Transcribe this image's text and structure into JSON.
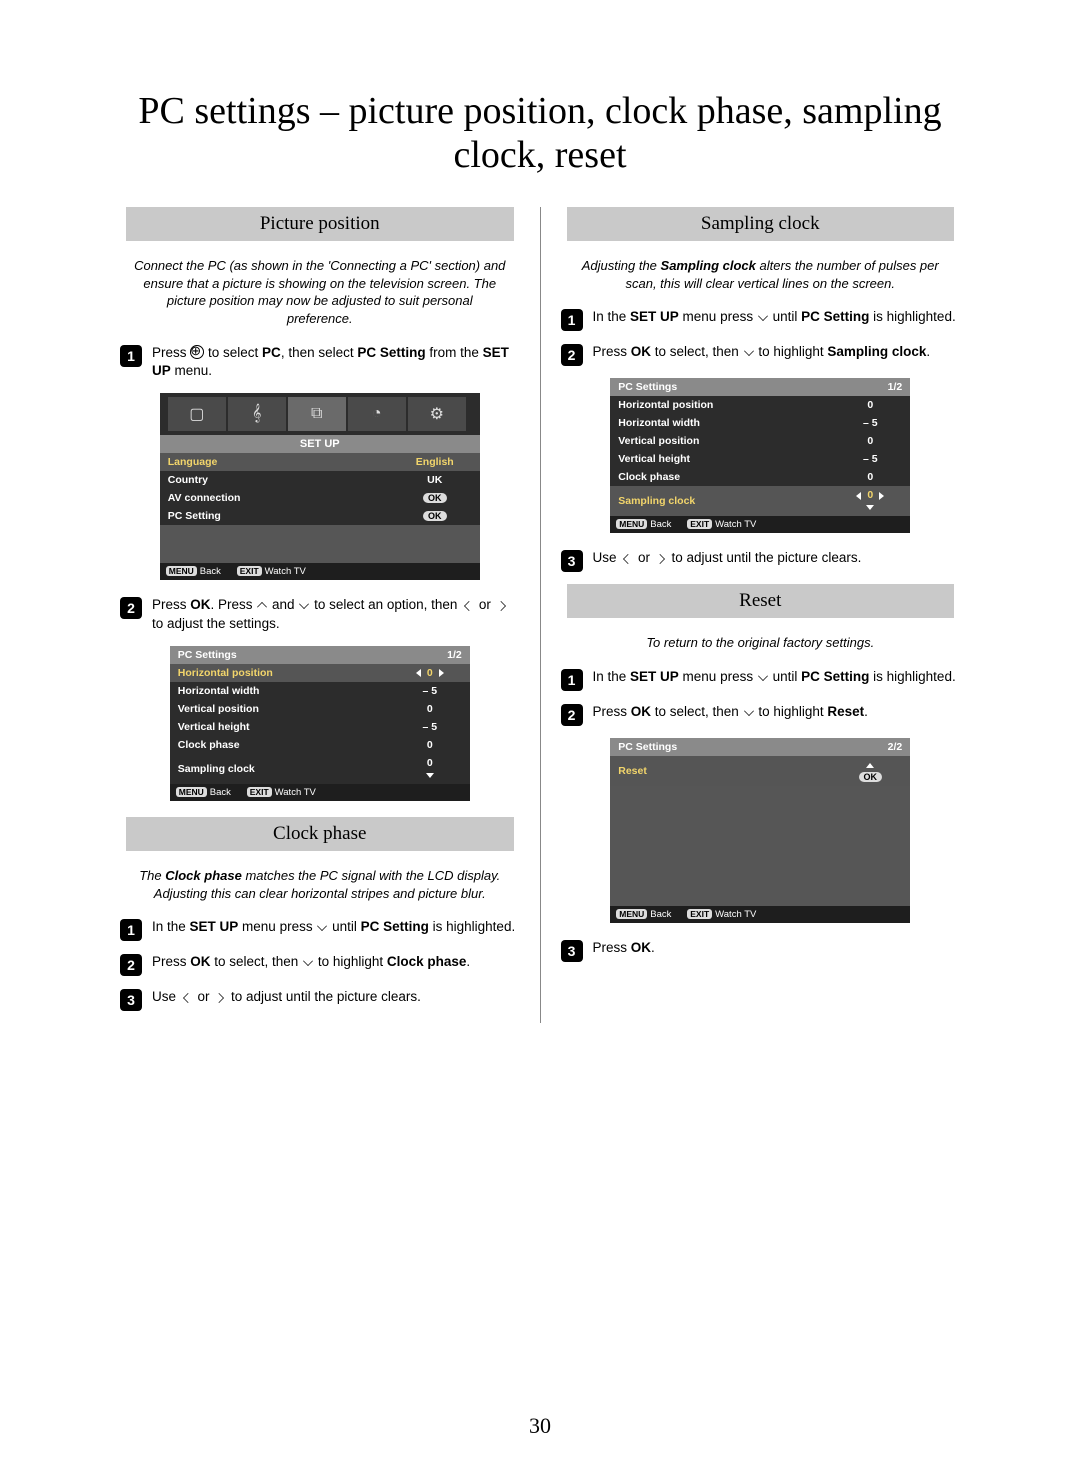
{
  "title": "PC settings – picture position, clock phase, sampling clock, reset",
  "page_number": "30",
  "left": {
    "picture_position": {
      "heading": "Picture position",
      "intro": "Connect the PC (as shown in the 'Connecting a PC' section) and ensure that a picture is showing on the television screen. The picture position may now be adjusted to suit personal preference.",
      "step1_a": "Press ",
      "step1_b": " to select ",
      "step1_pc": "PC",
      "step1_c": ", then select ",
      "step1_pcs": "PC Setting",
      "step1_d": " from the ",
      "step1_setup": "SET UP",
      "step1_e": " menu.",
      "step2_a": "Press ",
      "step2_ok": "OK",
      "step2_b": ". Press ",
      "step2_c": " and ",
      "step2_d": " to select an option, then ",
      "step2_e": " or ",
      "step2_f": " to adjust the settings."
    },
    "setup_menu": {
      "title": "SET UP",
      "rows": [
        {
          "label": "Language",
          "value": "English",
          "hl": true
        },
        {
          "label": "Country",
          "value": "UK"
        },
        {
          "label": "AV connection",
          "value": "OK"
        },
        {
          "label": "PC Setting",
          "value": "OK"
        }
      ],
      "footer_back": "Back",
      "footer_watch": "Watch TV",
      "menu_key": "MENU",
      "exit_key": "EXIT"
    },
    "pcsettings1": {
      "title": "PC Settings",
      "page": "1/2",
      "rows": [
        {
          "label": "Horizontal position",
          "value": "0",
          "hl": true,
          "arrows": true
        },
        {
          "label": "Horizontal width",
          "value": "– 5"
        },
        {
          "label": "Vertical position",
          "value": "0"
        },
        {
          "label": "Vertical height",
          "value": "– 5"
        },
        {
          "label": "Clock phase",
          "value": "0"
        },
        {
          "label": "Sampling clock",
          "value": "0",
          "downtri": true
        }
      ]
    },
    "clock_phase": {
      "heading": "Clock phase",
      "intro_a": "The ",
      "intro_b": "Clock phase",
      "intro_c": " matches the PC signal with the LCD display. Adjusting this can clear horizontal stripes and picture blur.",
      "s1_a": "In the ",
      "s1_b": "SET UP",
      "s1_c": " menu press ",
      "s1_d": " until ",
      "s1_e": "PC Setting",
      "s1_f": " is highlighted.",
      "s2_a": "Press ",
      "s2_ok": "OK",
      "s2_b": " to select, then ",
      "s2_c": " to highlight ",
      "s2_d": "Clock phase",
      "s2_e": ".",
      "s3_a": "Use ",
      "s3_b": " or ",
      "s3_c": " to adjust until the picture clears."
    }
  },
  "right": {
    "sampling_clock": {
      "heading": "Sampling clock",
      "intro_a": "Adjusting the ",
      "intro_b": "Sampling clock",
      "intro_c": " alters the number of pulses per scan, this will clear vertical lines on the screen.",
      "s1_a": "In the ",
      "s1_b": "SET UP",
      "s1_c": " menu press ",
      "s1_d": " until ",
      "s1_e": "PC Setting",
      "s1_f": " is highlighted.",
      "s2_a": "Press ",
      "s2_ok": "OK",
      "s2_b": " to select, then ",
      "s2_c": " to highlight ",
      "s2_d": "Sampling clock",
      "s2_e": ".",
      "s3_a": "Use ",
      "s3_b": " or ",
      "s3_c": " to adjust until the picture clears."
    },
    "pcsettings2": {
      "title": "PC Settings",
      "page": "1/2",
      "rows": [
        {
          "label": "Horizontal position",
          "value": "0"
        },
        {
          "label": "Horizontal width",
          "value": "– 5"
        },
        {
          "label": "Vertical position",
          "value": "0"
        },
        {
          "label": "Vertical height",
          "value": "– 5"
        },
        {
          "label": "Clock phase",
          "value": "0"
        },
        {
          "label": "Sampling clock",
          "value": "0",
          "hl": true,
          "arrows": true,
          "downtri": true
        }
      ]
    },
    "reset": {
      "heading": "Reset",
      "intro": "To return to the original factory settings.",
      "s1_a": "In the ",
      "s1_b": "SET UP",
      "s1_c": " menu press ",
      "s1_d": " until ",
      "s1_e": "PC Setting",
      "s1_f": " is highlighted.",
      "s2_a": "Press ",
      "s2_ok": "OK",
      "s2_b": " to select, then ",
      "s2_c": " to highlight ",
      "s2_d": "Reset",
      "s2_e": ".",
      "s3": "Press ",
      "s3_ok": "OK",
      "s3_b": "."
    },
    "pcsettings3": {
      "title": "PC Settings",
      "page": "2/2",
      "rows": [
        {
          "label": "Reset",
          "value": "OK",
          "hl": true,
          "uptri": true
        }
      ]
    },
    "footer": {
      "back": "Back",
      "watch": "Watch TV",
      "menu": "MENU",
      "exit": "EXIT"
    }
  }
}
